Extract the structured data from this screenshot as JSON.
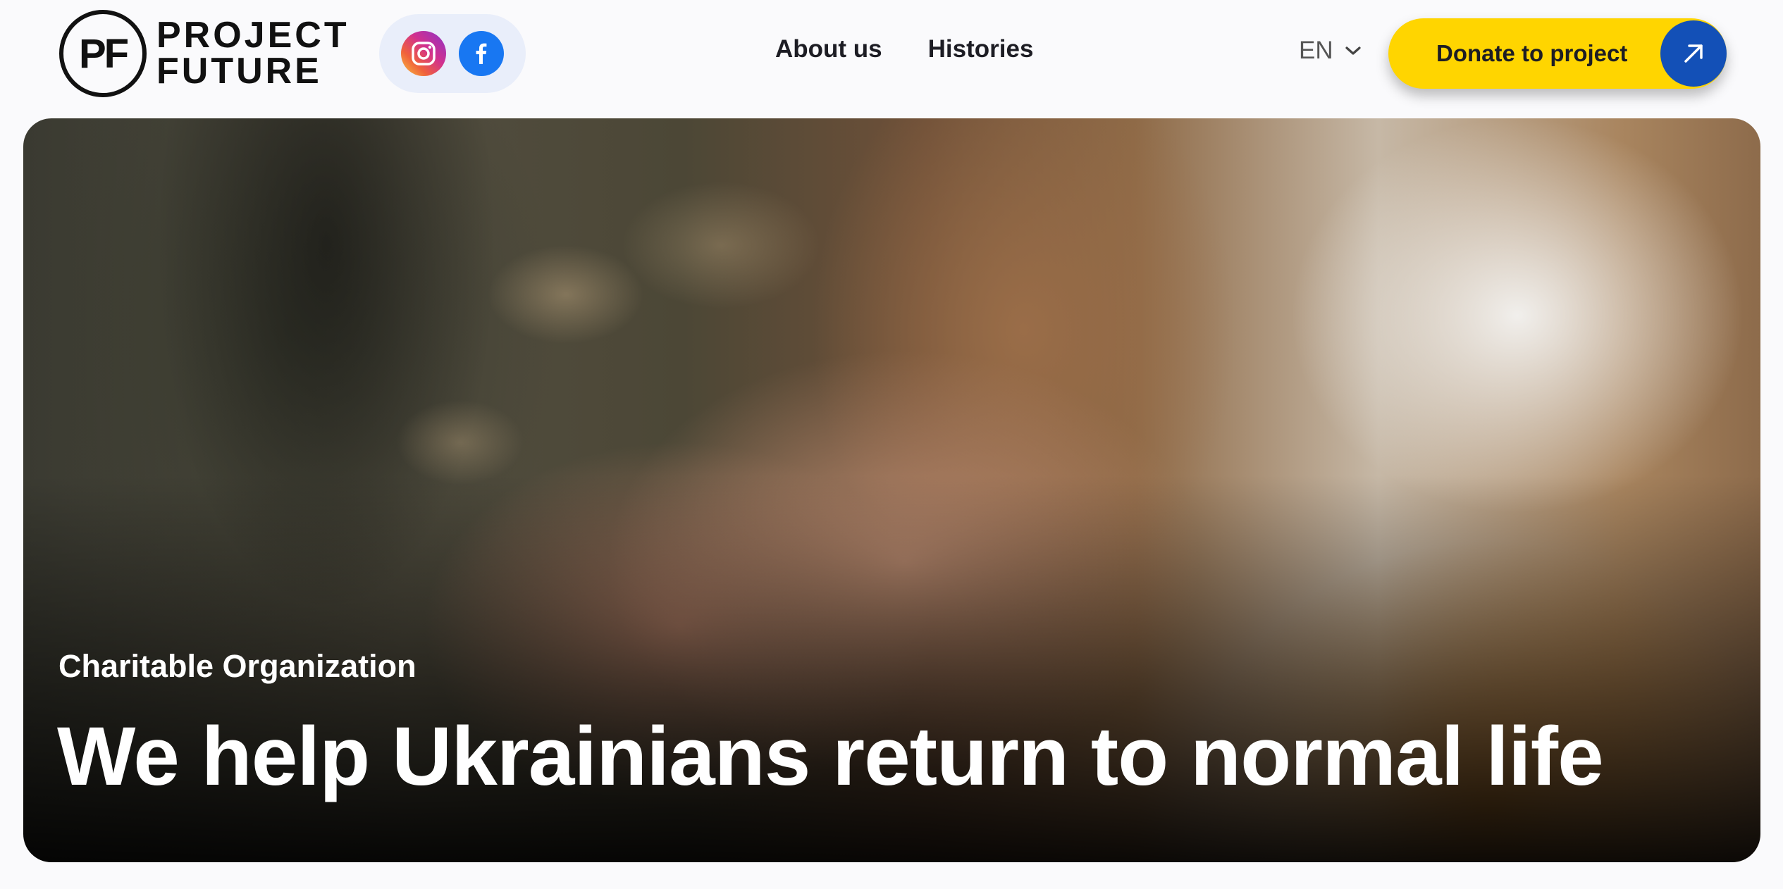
{
  "header": {
    "logo": {
      "mark": "PF",
      "line1": "PROJECT",
      "line2": "FUTURE"
    },
    "social": [
      {
        "icon": "instagram-icon"
      },
      {
        "icon": "facebook-icon"
      }
    ],
    "nav": [
      {
        "label": "About us"
      },
      {
        "label": "Histories"
      }
    ],
    "language": {
      "selected": "EN",
      "icon": "chevron-down-icon"
    },
    "donate": {
      "label": "Donate to project",
      "icon": "arrow-up-right-icon"
    }
  },
  "hero": {
    "subtitle": "Charitable Organization",
    "title": "We help Ukrainians return to normal life"
  },
  "colors": {
    "accent_yellow": "#ffd500",
    "accent_blue": "#1350b7",
    "social_bg": "#e9eefa",
    "facebook_blue": "#1877f2",
    "text_dark": "#1d1d24"
  }
}
